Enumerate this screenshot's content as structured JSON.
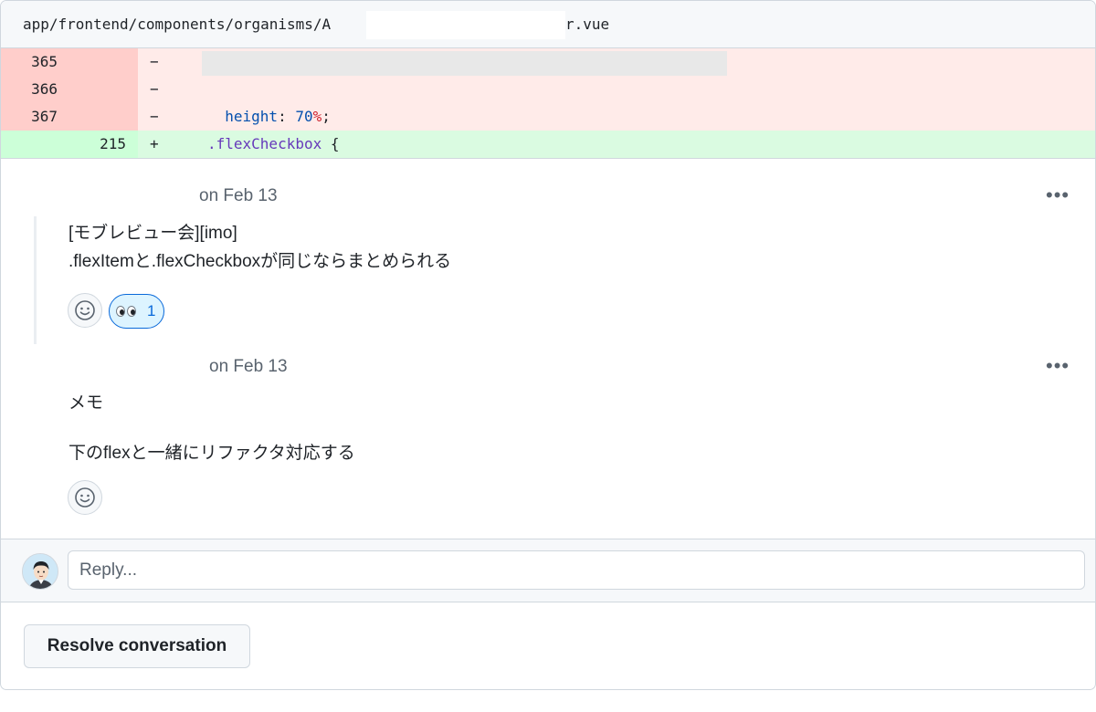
{
  "file": {
    "path_prefix": "app/frontend/components/organisms/A",
    "path_suffix": "r.vue"
  },
  "diff": {
    "rows": [
      {
        "type": "del",
        "old": "365",
        "new": "",
        "marker": "−"
      },
      {
        "type": "del",
        "old": "366",
        "new": "",
        "marker": "−"
      },
      {
        "type": "del",
        "old": "367",
        "new": "",
        "marker": "−",
        "prop": "height",
        "colon": ": ",
        "num": "70",
        "unit": "%",
        "semi": ";"
      },
      {
        "type": "add",
        "old": "",
        "new": "215",
        "marker": "+",
        "selector": ".flexCheckbox",
        "brace": " {"
      }
    ]
  },
  "comments": [
    {
      "meta": "on Feb 13",
      "menu_label": "•••",
      "lines": [
        "[モブレビュー会][imo]",
        ".flexItemと.flexCheckboxが同じならまとめられる"
      ],
      "reaction": {
        "emoji": "eyes",
        "count": "1"
      },
      "add_reaction_icon": "smiley-icon"
    },
    {
      "meta": "on Feb 13",
      "menu_label": "•••",
      "lines": [
        "メモ",
        "下のflexと一緒にリファクタ対応する"
      ],
      "add_reaction_icon": "smiley-icon"
    }
  ],
  "reply": {
    "placeholder": "Reply..."
  },
  "actions": {
    "resolve_label": "Resolve conversation"
  },
  "colors": {
    "deleted_bg": "#ffebe9",
    "deleted_gutter": "#ffcecb",
    "added_bg": "#dafbe1",
    "added_gutter": "#ccffd8",
    "reaction_bg": "#ddf4ff",
    "reaction_border": "#0969da"
  }
}
